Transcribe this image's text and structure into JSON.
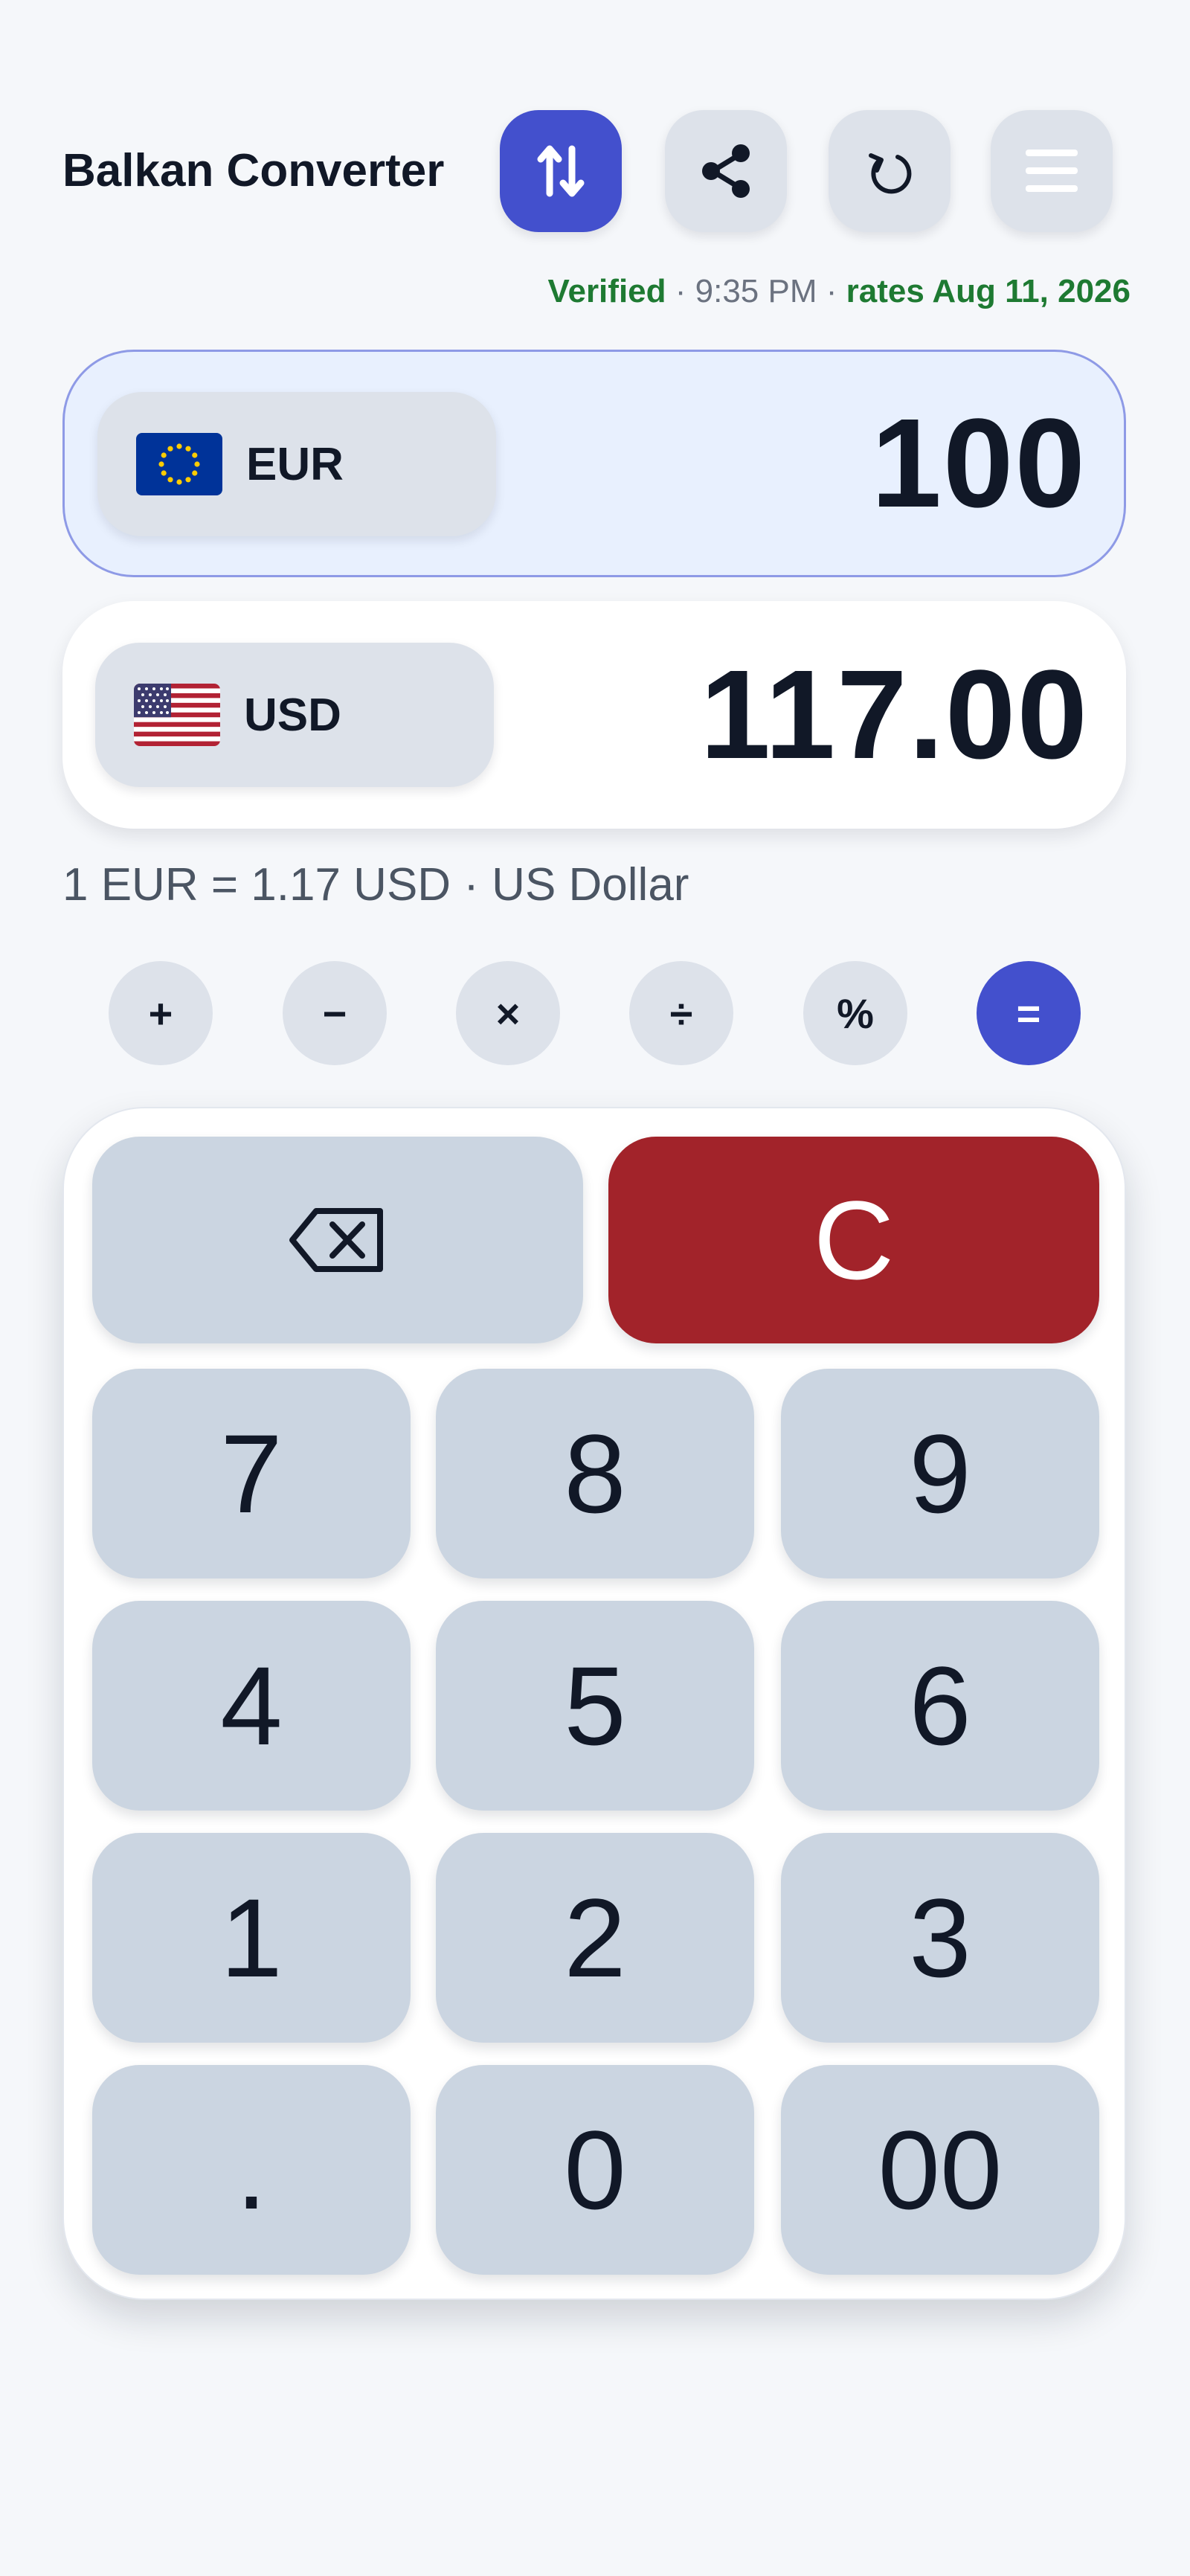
{
  "header": {
    "title": "Balkan Converter",
    "buttons": [
      {
        "name": "swap-button",
        "icon": "swap-arrows-icon"
      },
      {
        "name": "share-button",
        "icon": "share-icon"
      },
      {
        "name": "refresh-button",
        "icon": "refresh-icon"
      },
      {
        "name": "menu-button",
        "icon": "hamburger-menu-icon"
      }
    ]
  },
  "status": {
    "verified": "Verified",
    "sep1": " · ",
    "time": "9:35 PM",
    "sep2": " · ",
    "rates_date": "rates Aug 11, 2026"
  },
  "from": {
    "code": "EUR",
    "flag": "eu-flag-icon",
    "amount": "100"
  },
  "to": {
    "code": "USD",
    "flag": "us-flag-icon",
    "amount": "117.00"
  },
  "rate_line": "1 EUR = 1.17 USD · US Dollar",
  "operators": [
    "+",
    "−",
    "×",
    "÷",
    "%",
    "="
  ],
  "keypad": {
    "backspace_icon": "backspace-icon",
    "clear": "C",
    "digits": [
      "7",
      "8",
      "9",
      "4",
      "5",
      "6",
      "1",
      "2",
      "3",
      ".",
      "0",
      "00"
    ]
  },
  "colors": {
    "accent": "#4350cd",
    "clear": "#a2232a",
    "verified": "#1e7a32"
  }
}
